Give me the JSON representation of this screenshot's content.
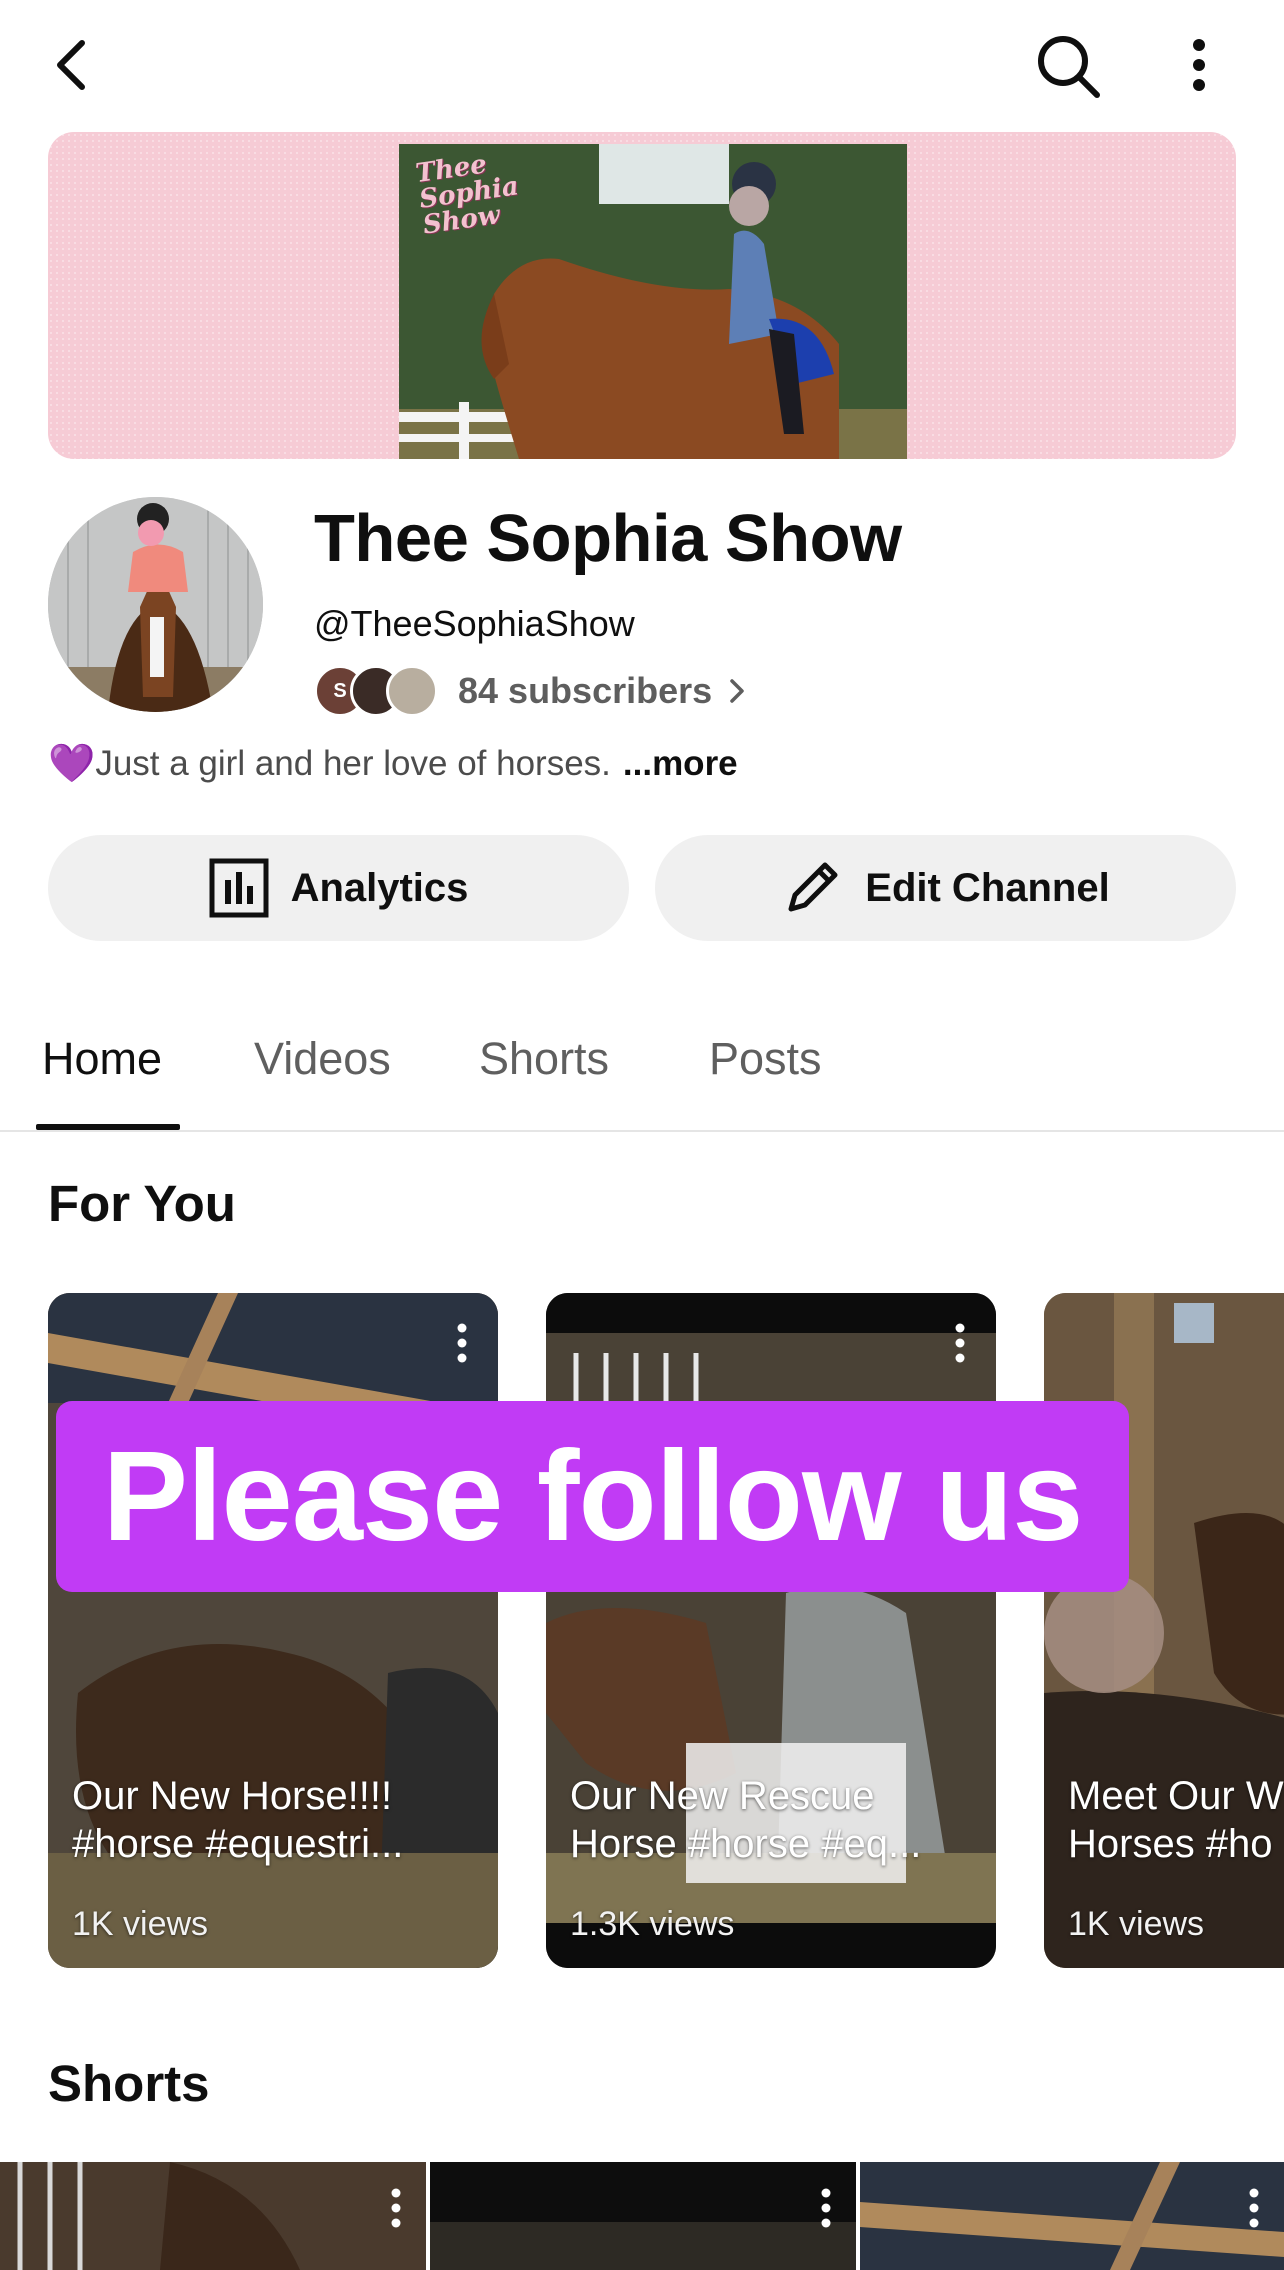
{
  "top_bar": {
    "back_icon": "chevron-left-icon",
    "search_icon": "search-icon",
    "more_icon": "more-vertical-icon"
  },
  "banner": {
    "logo_text": "Thee Sophia Show"
  },
  "channel": {
    "title": "Thee Sophia Show",
    "handle": "@TheeSophiaShow",
    "subscriber_avatars": [
      "S",
      "",
      ""
    ],
    "subscribers": "84 subscribers",
    "description_emoji": "💜",
    "description": "Just a girl and her love of horses.",
    "more_label": "...more"
  },
  "actions": {
    "analytics_label": "Analytics",
    "edit_label": "Edit Channel"
  },
  "tabs": [
    {
      "label": "Home",
      "active": true
    },
    {
      "label": "Videos",
      "active": false
    },
    {
      "label": "Shorts",
      "active": false
    },
    {
      "label": "Posts",
      "active": false
    }
  ],
  "for_you": {
    "title": "For You",
    "videos": [
      {
        "title": "Our New Horse!!!!\n#horse #equestri...",
        "views": "1K views"
      },
      {
        "title": "Our New Rescue\nHorse #horse #eq...",
        "views": "1.3K views"
      },
      {
        "title": "Meet Our W\nHorses #ho",
        "views": "1K views"
      }
    ]
  },
  "overlay": {
    "follow_text": "Please follow us"
  },
  "shorts": {
    "title": "Shorts"
  },
  "colors": {
    "accent": "#c13bf5",
    "banner_pink": "#f6cbd5",
    "pill_bg": "#f0f0f0"
  }
}
